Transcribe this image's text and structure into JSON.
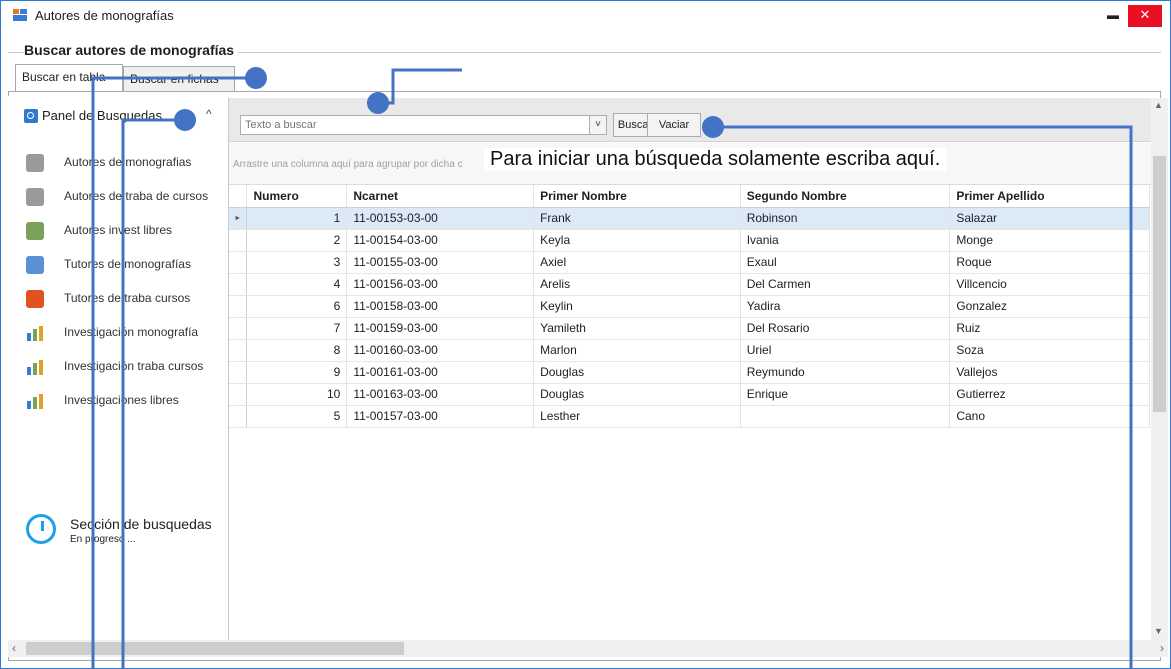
{
  "window": {
    "title": "Autores de monografías",
    "minimize": "▬",
    "close": "✕"
  },
  "group": {
    "title": "Buscar autores de monografías"
  },
  "tabs": [
    {
      "label": "Buscar en tabla"
    },
    {
      "label": "Buscar en fichas"
    }
  ],
  "side_panel": {
    "header": "Panel de Busquedas",
    "chevron": "^",
    "items": [
      {
        "label": "Autores de monografias",
        "icon": "person-gray-icon"
      },
      {
        "label": "Autores de traba de cursos",
        "icon": "person-gray-icon"
      },
      {
        "label": "Autores invest libres",
        "icon": "person-green-icon"
      },
      {
        "label": "Tutores de monografías",
        "icon": "person-blue-icon"
      },
      {
        "label": "Tutores de traba cursos",
        "icon": "person-orange-icon"
      },
      {
        "label": "Investigación monografía",
        "icon": "chart-icon"
      },
      {
        "label": "Investigación traba cursos",
        "icon": "chart-icon"
      },
      {
        "label": "Investigaciones libres",
        "icon": "chart-icon"
      }
    ],
    "progress_title": "Sección de busquedas",
    "progress_sub": "En progreso ..."
  },
  "toolbar": {
    "search_placeholder": "Texto a buscar",
    "dropdown": "˅",
    "search_button": "Buscar",
    "clear_button": "Vaciar"
  },
  "group_panel_hint": "Arrastre una columna aquí para agrupar por dicha columna",
  "annotation": "Para iniciar una búsqueda solamente escriba aquí.",
  "table": {
    "columns": [
      "Numero",
      "Ncarnet",
      "Primer Nombre",
      "Segundo Nombre",
      "Primer Apellido"
    ],
    "rows": [
      [
        "1",
        "11-00153-03-00",
        "Frank",
        "Robinson",
        "Salazar"
      ],
      [
        "2",
        "11-00154-03-00",
        "Keyla",
        "Ivania",
        "Monge"
      ],
      [
        "3",
        "11-00155-03-00",
        "Axiel",
        "Exaul",
        "Roque"
      ],
      [
        "4",
        "11-00156-03-00",
        "Arelis",
        "Del Carmen",
        "Villcencio"
      ],
      [
        "6",
        "11-00158-03-00",
        "Keylin",
        "Yadira",
        "Gonzalez"
      ],
      [
        "7",
        "11-00159-03-00",
        "Yamileth",
        "Del Rosario",
        "Ruiz"
      ],
      [
        "8",
        "11-00160-03-00",
        "Marlon",
        "Uriel",
        "Soza"
      ],
      [
        "9",
        "11-00161-03-00",
        "Douglas",
        "Reymundo",
        "Vallejos"
      ],
      [
        "10",
        "11-00163-03-00",
        "Douglas",
        "Enrique",
        "Gutierrez"
      ],
      [
        "5",
        "11-00157-03-00",
        "Lesther",
        "",
        "Cano"
      ]
    ],
    "selected_row": 0,
    "row_indicator": "►"
  },
  "colors": {
    "accent": "#4472c4",
    "title_close": "#e81123",
    "selection": "#dce9f7"
  }
}
